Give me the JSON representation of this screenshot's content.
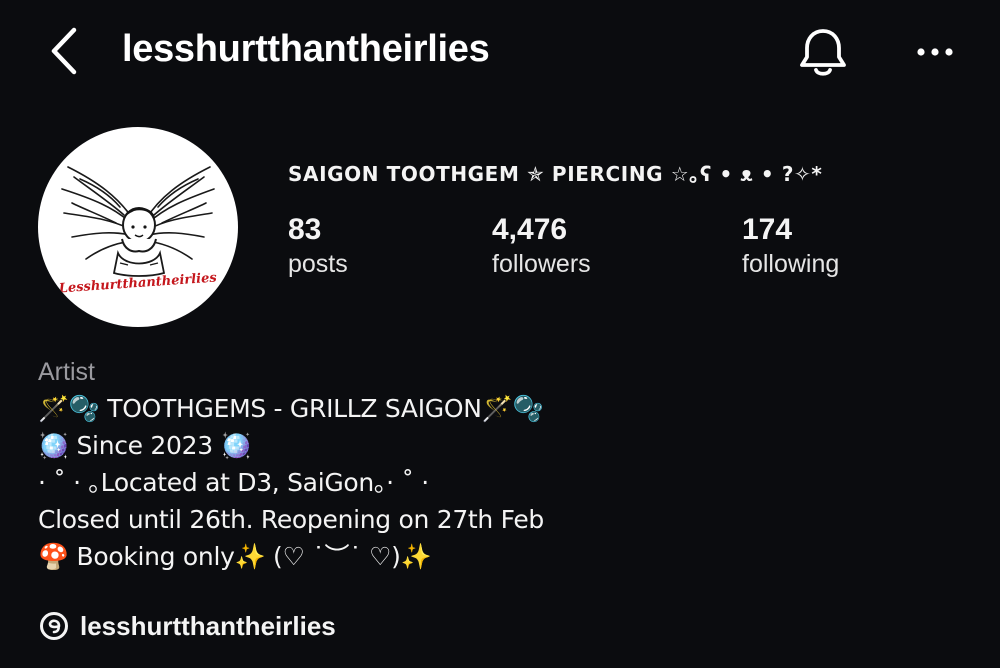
{
  "header": {
    "username": "lesshurtthantheirlies",
    "back_icon": "chevron-left-icon",
    "bell_icon": "bell-icon",
    "more_icon": "more-horizontal-icon"
  },
  "profile": {
    "avatar_logo_text": "Lesshurtthantheirlies",
    "category_name": "SAIGON TOOTHGEM ✯ PIERCING ☆｡ʕ • ᴥ • ?✧*",
    "stats": {
      "posts": {
        "value": "83",
        "label": "posts"
      },
      "followers": {
        "value": "4,476",
        "label": "followers"
      },
      "following": {
        "value": "174",
        "label": "following"
      }
    }
  },
  "bio": {
    "category": "Artist",
    "lines": [
      "🪄🫧 TOOTHGEMS - GRILLZ SAIGON🪄🫧",
      "🪩 Since 2023 🪩",
      "· ˚ · ｡Located at D3, SaiGon｡· ˚ ·",
      "Closed until 26th. Reopening on 27th Feb",
      "🍄 Booking only✨ (♡ ˙︶˙ ♡)✨"
    ]
  },
  "threads": {
    "icon": "threads-icon",
    "handle": "lesshurtthantheirlies"
  },
  "colors": {
    "background": "#0b0c0f",
    "text": "#f4f4f4",
    "muted": "#9a9a9f",
    "logo_red": "#c4161c"
  }
}
